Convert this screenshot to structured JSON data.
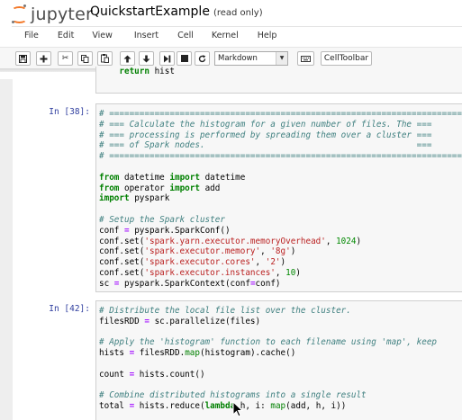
{
  "header": {
    "logo_text": "jupyter",
    "notebook_name": "QuickstartExample",
    "status": "(read only)"
  },
  "menu": [
    "File",
    "Edit",
    "View",
    "Insert",
    "Cell",
    "Kernel",
    "Help"
  ],
  "toolbar": {
    "buttons": [
      "save-icon",
      "plus-icon",
      "cut-icon",
      "copy-icon",
      "paste-icon",
      "arrow-up-icon",
      "arrow-down-icon",
      "step-forward-icon",
      "stop-icon",
      "refresh-icon",
      "keyboard-icon"
    ],
    "cell_type": "Markdown",
    "celltoolbar_label": "CellToolbar"
  },
  "cells": [
    {
      "prompt": "",
      "lines": [
        "    return hist"
      ]
    },
    {
      "prompt": "In [38]:",
      "lines": [
        "# ==============================================================================",
        "# === Calculate the histogram for a given number of files. The ===",
        "# === processing is performed by spreading them over a cluster ===",
        "# === of Spark nodes.                                          ===",
        "# ==============================================================================",
        "",
        "from datetime import datetime",
        "from operator import add",
        "import pyspark",
        "",
        "# Setup the Spark cluster",
        "conf = pyspark.SparkConf()",
        "conf.set('spark.yarn.executor.memoryOverhead', 1024)",
        "conf.set('spark.executor.memory', '8g')",
        "conf.set('spark.executor.cores', '2')",
        "conf.set('spark.executor.instances', 10)",
        "sc = pyspark.SparkContext(conf=conf)"
      ]
    },
    {
      "prompt": "In [42]:",
      "lines": [
        "# Distribute the local file list over the cluster.",
        "filesRDD = sc.parallelize(files)",
        "",
        "# Apply the 'histogram' function to each filename using 'map', keep",
        "hists = filesRDD.map(histogram).cache()",
        "",
        "count = hists.count()",
        "",
        "# Combine distributed histograms into a single result",
        "total = hists.reduce(lambda h, i: map(add, h, i))"
      ]
    }
  ],
  "colors": {
    "keyword": "#008000",
    "comment": "#408080",
    "string": "#BA2121",
    "prompt": "#303F9F",
    "logo_orange": "#F37726"
  }
}
